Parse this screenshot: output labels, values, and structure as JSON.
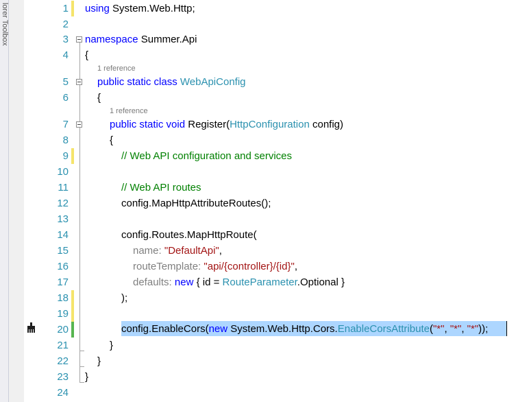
{
  "side_panel": {
    "label": "lorer Toolbox"
  },
  "code": {
    "line_numbers": [
      "1",
      "2",
      "3",
      "4",
      "5",
      "6",
      "7",
      "8",
      "9",
      "10",
      "11",
      "12",
      "13",
      "14",
      "15",
      "16",
      "17",
      "18",
      "19",
      "20",
      "21",
      "22",
      "23",
      "24"
    ],
    "ref_labels": {
      "class": "1 reference",
      "method": "1 reference"
    },
    "t": {
      "using_kw": "using",
      "using_ns": " System.Web.Http;",
      "namespace_kw": "namespace",
      "namespace_name": " Summer.Api",
      "brace_open": "{",
      "brace_close": "}",
      "class_kw": "public static class ",
      "class_name": "WebApiConfig",
      "method_kw": "public static void",
      "method_name": " Register(",
      "param_type": "HttpConfiguration",
      "param_name": " config)",
      "comment_1": "// Web API configuration and services",
      "comment_2": "// Web API routes",
      "map_attr": "config.MapHttpAttributeRoutes();",
      "map_route": "config.Routes.MapHttpRoute(",
      "p_name": "name:",
      "v_name": "\"DefaultApi\"",
      "comma": ",",
      "p_template": "routeTemplate:",
      "v_template": "\"api/{controller}/{id}\"",
      "p_defaults": "defaults:",
      "new_kw": "new",
      "defaults_mid": " { id = ",
      "route_param": "RouteParameter",
      "defaults_end": ".Optional }",
      "close_paren": ");",
      "cors_start": "config.EnableCors(",
      "cors_ns": " System.Web.Http.Cors.",
      "cors_attr": "EnableCorsAttribute",
      "cors_open": "(",
      "star": "\"*\"",
      "sep": ", ",
      "cors_end": "));"
    }
  },
  "colors": {
    "keyword": "#0000ff",
    "type": "#2b91af",
    "comment": "#008000",
    "string": "#a31515",
    "selection": "#add6ff",
    "change_saved": "#57b550",
    "change_unsaved": "#f5e46b"
  }
}
